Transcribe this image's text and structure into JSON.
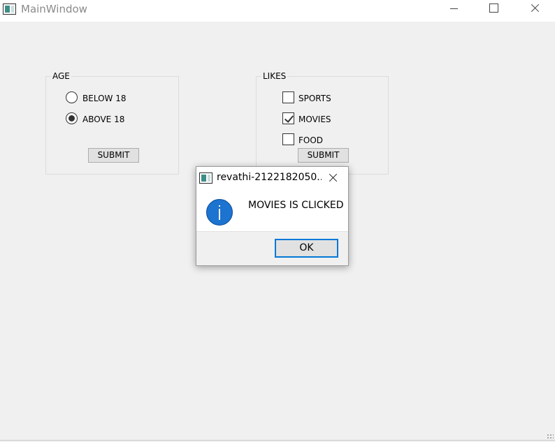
{
  "window": {
    "title": "MainWindow"
  },
  "age_group": {
    "title": "AGE",
    "options": [
      {
        "label": "BELOW 18",
        "checked": false
      },
      {
        "label": "ABOVE 18",
        "checked": true
      }
    ],
    "submit_label": "SUBMIT"
  },
  "likes_group": {
    "title": "LIKES",
    "options": [
      {
        "label": "SPORTS",
        "checked": false
      },
      {
        "label": "MOVIES",
        "checked": true
      },
      {
        "label": "FOOD",
        "checked": false
      }
    ],
    "submit_label": "SUBMIT"
  },
  "dialog": {
    "title": "revathi-2122182050...",
    "message": "MOVIES IS CLICKED",
    "icon": "info-icon",
    "ok_label": "OK"
  },
  "colors": {
    "accent": "#0078d7",
    "info": "#1c73d0",
    "background": "#f0f0f0"
  }
}
